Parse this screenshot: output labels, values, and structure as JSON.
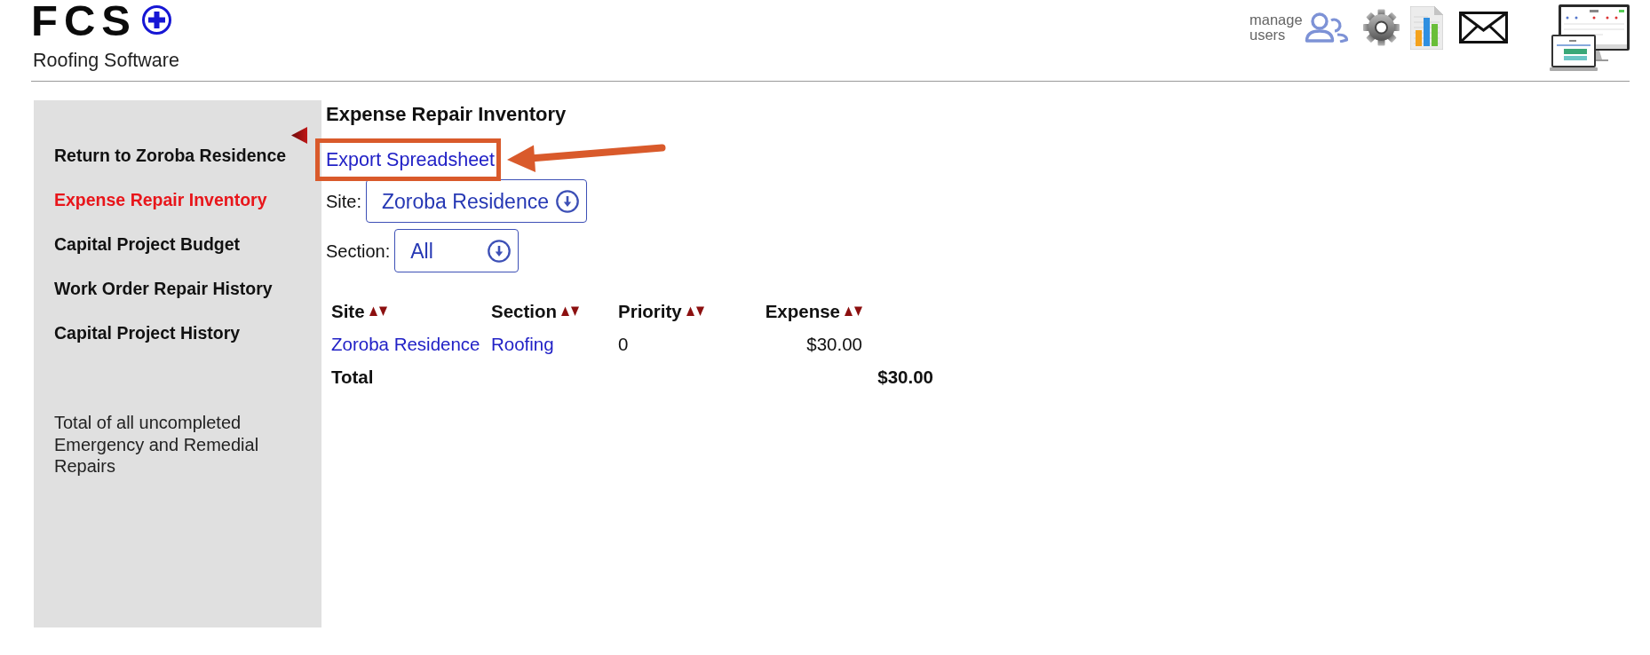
{
  "header": {
    "logo": {
      "wordmark": "FCS",
      "tagline": "Roofing Software"
    },
    "manage_users": {
      "label": "manage users"
    }
  },
  "sidebar": {
    "items": [
      {
        "label": "Return to Zoroba Residence",
        "selected": false
      },
      {
        "label": "Expense Repair Inventory",
        "selected": true
      },
      {
        "label": "Capital Project Budget",
        "selected": false
      },
      {
        "label": "Work Order Repair History",
        "selected": false
      },
      {
        "label": "Capital Project History",
        "selected": false
      }
    ],
    "note": "Total of all uncompleted Emergency and Remedial Repairs"
  },
  "main": {
    "title": "Expense Repair Inventory",
    "export_link": {
      "label": "Export Spreadsheet",
      "highlighted": true
    },
    "filters": [
      {
        "label": "Site:",
        "value": "Zoroba Residence"
      },
      {
        "label": "Section:",
        "value": "All"
      }
    ],
    "table": {
      "columns": [
        {
          "label": "Site",
          "kind": "link"
        },
        {
          "label": "Section",
          "kind": "link"
        },
        {
          "label": "Priority",
          "kind": "text"
        },
        {
          "label": "Expense",
          "kind": "amount"
        }
      ],
      "rows": [
        {
          "cells": [
            "Zoroba Residence",
            "Roofing",
            "0",
            "$30.00"
          ]
        }
      ],
      "total": {
        "label": "Total",
        "value": "$30.00"
      }
    }
  }
}
